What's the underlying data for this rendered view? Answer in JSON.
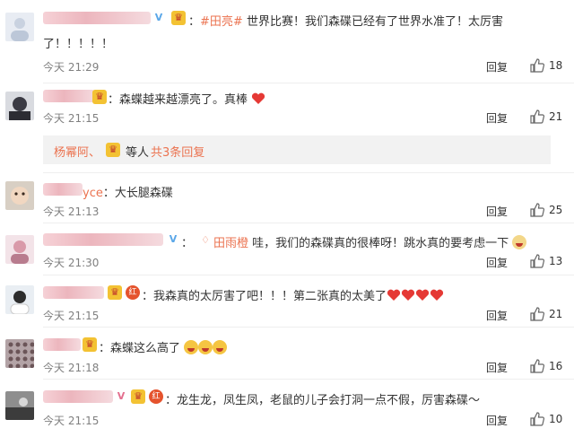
{
  "comments": [
    {
      "text_pre": "：",
      "hashtag": "#田亮#",
      "text": " 世界比赛！我们森碟已经有了世界水准了！太厉害",
      "text_line2": "了！！！！！",
      "time": "今天 21:29",
      "reply": "回复",
      "likes": "18"
    },
    {
      "text": "：森蝶越来越漂亮了。真棒",
      "time": "今天 21:15",
      "reply": "回复",
      "likes": "21",
      "sub_name": "杨幂阿、",
      "sub_text": "等人",
      "sub_link": "共3条回复"
    },
    {
      "name_tail": "yce",
      "text": "：大长腿森碟",
      "time": "今天 21:13",
      "reply": "回复",
      "likes": "25"
    },
    {
      "mention": "田雨橙",
      "text": " 哇，我们的森碟真的很棒呀！跳水真的要考虑一下",
      "time": "今天 21:30",
      "reply": "回复",
      "likes": "13"
    },
    {
      "text": "：我森真的太厉害了吧！！！第二张真的太美了",
      "time": "今天 21:15",
      "reply": "回复",
      "likes": "21"
    },
    {
      "text": "：森蝶这么高了",
      "time": "今天 21:18",
      "reply": "回复",
      "likes": "16"
    },
    {
      "text": "：龙生龙，凤生凤，老鼠的儿子会打洞一点不假，厉害森碟～",
      "time": "今天 21:15",
      "reply": "回复",
      "likes": "10"
    }
  ],
  "colors": {
    "link": "#eb7350",
    "muted": "#808080",
    "sub_bg": "#f2f2f2"
  },
  "icons": {
    "like": "thumbs-up-icon",
    "heart": "red-heart-emoji",
    "cry": "crying-face-emoji"
  }
}
